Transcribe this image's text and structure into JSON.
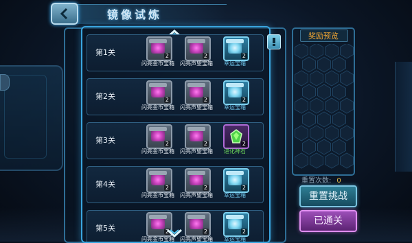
{
  "header": {
    "title": "镜像试炼",
    "back_icon": "back-arrow-icon"
  },
  "levels": [
    {
      "label": "第1关",
      "rewards": [
        {
          "name": "闪亮金币宝箱",
          "qty": "2",
          "type": "pink-chest"
        },
        {
          "name": "闪亮声望宝箱",
          "qty": "2",
          "type": "pink-chest"
        },
        {
          "name": "幸运宝箱",
          "qty": "2",
          "type": "blue-chest"
        }
      ]
    },
    {
      "label": "第2关",
      "rewards": [
        {
          "name": "闪亮金币宝箱",
          "qty": "2",
          "type": "pink-chest"
        },
        {
          "name": "闪亮声望宝箱",
          "qty": "2",
          "type": "pink-chest"
        },
        {
          "name": "幸运宝箱",
          "qty": "2",
          "type": "blue-chest"
        }
      ]
    },
    {
      "label": "第3关",
      "rewards": [
        {
          "name": "闪亮金币宝箱",
          "qty": "2",
          "type": "pink-chest"
        },
        {
          "name": "闪亮声望宝箱",
          "qty": "2",
          "type": "pink-chest"
        },
        {
          "name": "进化神石",
          "qty": "2",
          "type": "green-gem"
        }
      ]
    },
    {
      "label": "第4关",
      "rewards": [
        {
          "name": "闪亮金币宝箱",
          "qty": "2",
          "type": "pink-chest"
        },
        {
          "name": "闪亮声望宝箱",
          "qty": "2",
          "type": "pink-chest"
        },
        {
          "name": "幸运宝箱",
          "qty": "2",
          "type": "blue-chest"
        }
      ]
    },
    {
      "label": "第5关",
      "rewards": [
        {
          "name": "闪亮金币宝箱",
          "qty": "2",
          "type": "pink-chest"
        },
        {
          "name": "闪亮声望宝箱",
          "qty": "2",
          "type": "pink-chest"
        },
        {
          "name": "幸运宝箱",
          "qty": "2",
          "type": "blue-chest"
        }
      ]
    }
  ],
  "reward_preview": {
    "title": "奖励预览"
  },
  "reset": {
    "count_label": "重置次数:",
    "count_value": "0",
    "reset_button": "重置挑战",
    "cleared_button": "已通关"
  },
  "colors": {
    "accent_blue": "#3aa6e0",
    "title_orange": "#f0a533",
    "done_purple": "#9c4fb8",
    "reward_pink": "#c33fb8",
    "name_blue": "#6fc4ea",
    "name_green": "#6fdc5a"
  }
}
